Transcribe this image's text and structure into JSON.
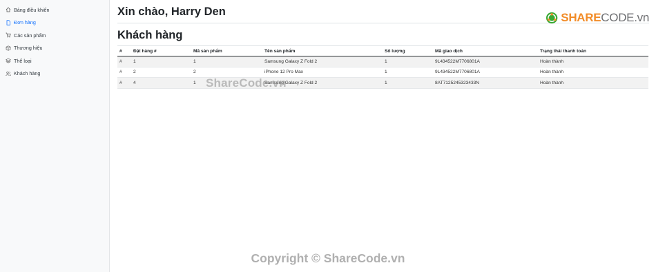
{
  "sidebar": {
    "items": [
      {
        "label": "Bảng điều khiển",
        "icon": "home-icon"
      },
      {
        "label": "Đơn hàng",
        "icon": "file-icon",
        "active": true
      },
      {
        "label": "Các sản phẩm",
        "icon": "cart-icon"
      },
      {
        "label": "Thương hiệu",
        "icon": "box-icon"
      },
      {
        "label": "Thể loại",
        "icon": "layers-icon"
      },
      {
        "label": "Khách hàng",
        "icon": "users-icon"
      }
    ]
  },
  "header": {
    "greeting": "Xin chào, Harry Den"
  },
  "section": {
    "title": "Khách hàng"
  },
  "table": {
    "columns": [
      "#",
      "Đặt hàng #",
      "Mã sản phẩm",
      "Tên sản phẩm",
      "Số lượng",
      "Mã giao dịch",
      "Trạng thái thanh toán"
    ],
    "rows": [
      [
        "#",
        "1",
        "1",
        "Samsung Galaxy Z Fold 2",
        "1",
        "9L434522M7706801A",
        "Hoàn thành"
      ],
      [
        "#",
        "2",
        "2",
        "iPhone 12 Pro Max",
        "1",
        "9L434522M7706801A",
        "Hoàn thành"
      ],
      [
        "#",
        "4",
        "1",
        "Samsung Galaxy Z Fold 2",
        "1",
        "8AT7125245323433N",
        "Hoàn thành"
      ]
    ]
  },
  "logo": {
    "part1": "SHARE",
    "part2": "CODE.vn"
  },
  "watermarks": {
    "middle": "ShareCode.vn",
    "footer": "Copyright © ShareCode.vn"
  },
  "colors": {
    "active": "#0d6efd",
    "logo_orange": "#f28c28",
    "logo_green": "#3aa935"
  }
}
